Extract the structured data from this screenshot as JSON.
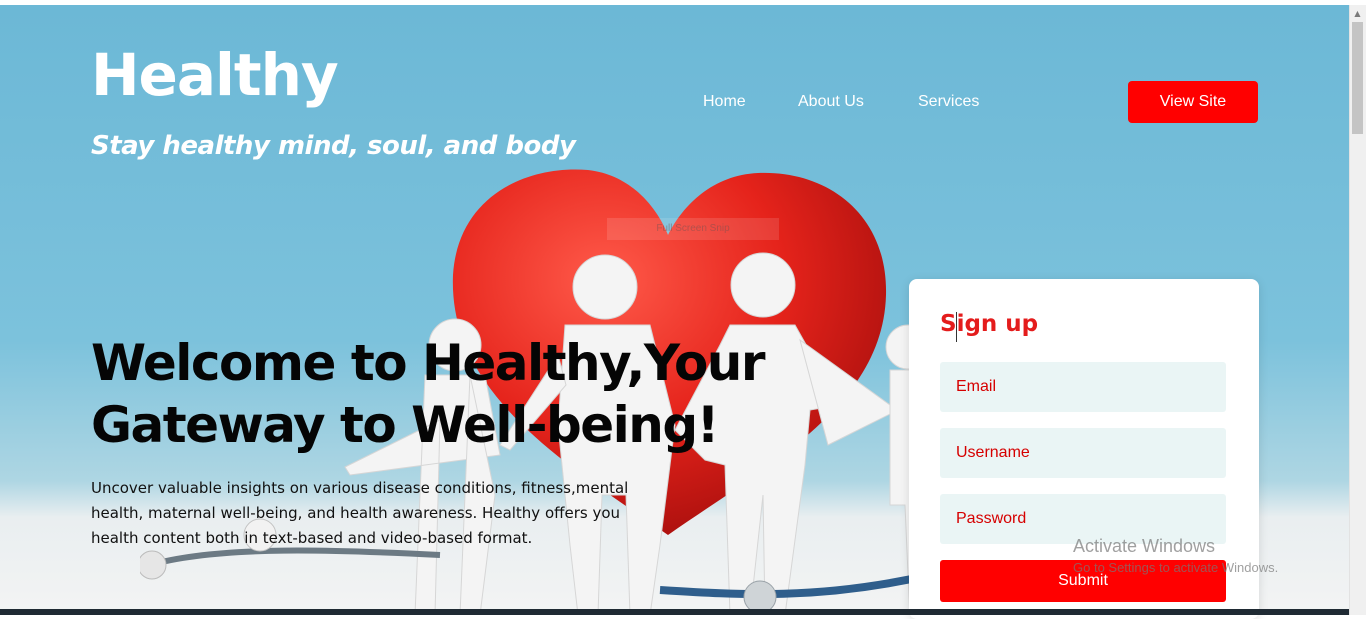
{
  "brand": {
    "logo": "Healthy",
    "tagline": "Stay healthy mind, soul, and body"
  },
  "nav": {
    "items": [
      "Home",
      "About Us",
      "Services"
    ],
    "cta": "View Site"
  },
  "overlay_text": "Full Screen Snip",
  "hero": {
    "headline": "Welcome to Healthy,Your Gateway to Well-being!",
    "description": "Uncover valuable insights on various disease conditions, fitness,mental health, maternal well-being, and health awareness. Healthy offers you health content both in text-based and video-based format."
  },
  "signup": {
    "title": "Sign up",
    "email_placeholder": "Email",
    "username_placeholder": "Username",
    "password_placeholder": "Password",
    "submit_label": "Submit"
  },
  "os_watermark": {
    "title": "Activate Windows",
    "subtitle": "Go to Settings to activate Windows."
  },
  "colors": {
    "accent": "#ff0000",
    "sky": "#6cb8d6",
    "field_bg": "#eaf5f5",
    "heading_red": "#e41c1c"
  },
  "icons": [
    "heart-illustration",
    "paper-family-illustration",
    "stethoscope-illustration"
  ]
}
